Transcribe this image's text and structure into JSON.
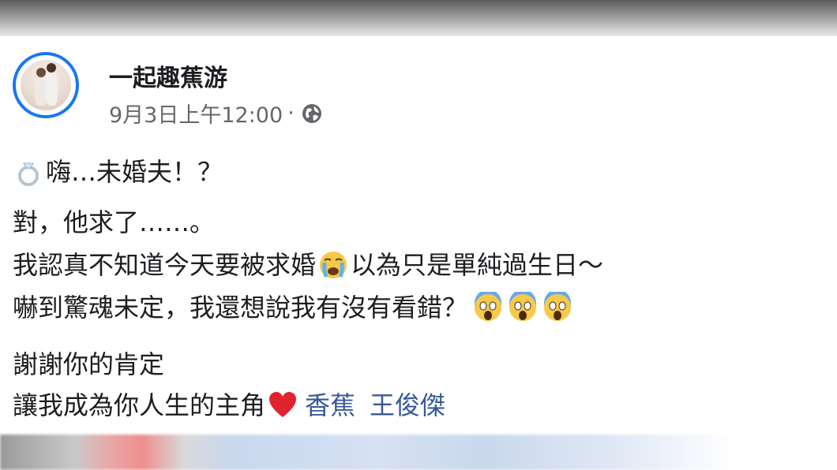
{
  "post": {
    "page_name": "一起趣蕉游",
    "timestamp": "9月3日上午12:00",
    "separator": "·",
    "privacy_icon": "globe-icon",
    "lines": {
      "l1_text": "嗨…未婚夫！？",
      "l1_emoji": "ring-emoji",
      "l2_text": "對，他求了……。",
      "l3_before": "我認真不知道今天要被求婚",
      "l3_emoji": "crying-face-emoji",
      "l3_after": "以為只是單純過生日～",
      "l4_text": "嚇到驚魂未定，我還想說我有沒有看錯？",
      "l4_emoji": "screaming-face-emoji",
      "l5_text": "謝謝你的肯定",
      "l6_text": "讓我成為你人生的主角",
      "l6_emoji": "red-heart-emoji"
    },
    "tags": [
      "香蕉",
      "王俊傑"
    ]
  },
  "colors": {
    "ring_blue": "#1877f2",
    "tag_blue": "#385898",
    "meta_gray": "#65676b",
    "text": "#1c1e21"
  }
}
